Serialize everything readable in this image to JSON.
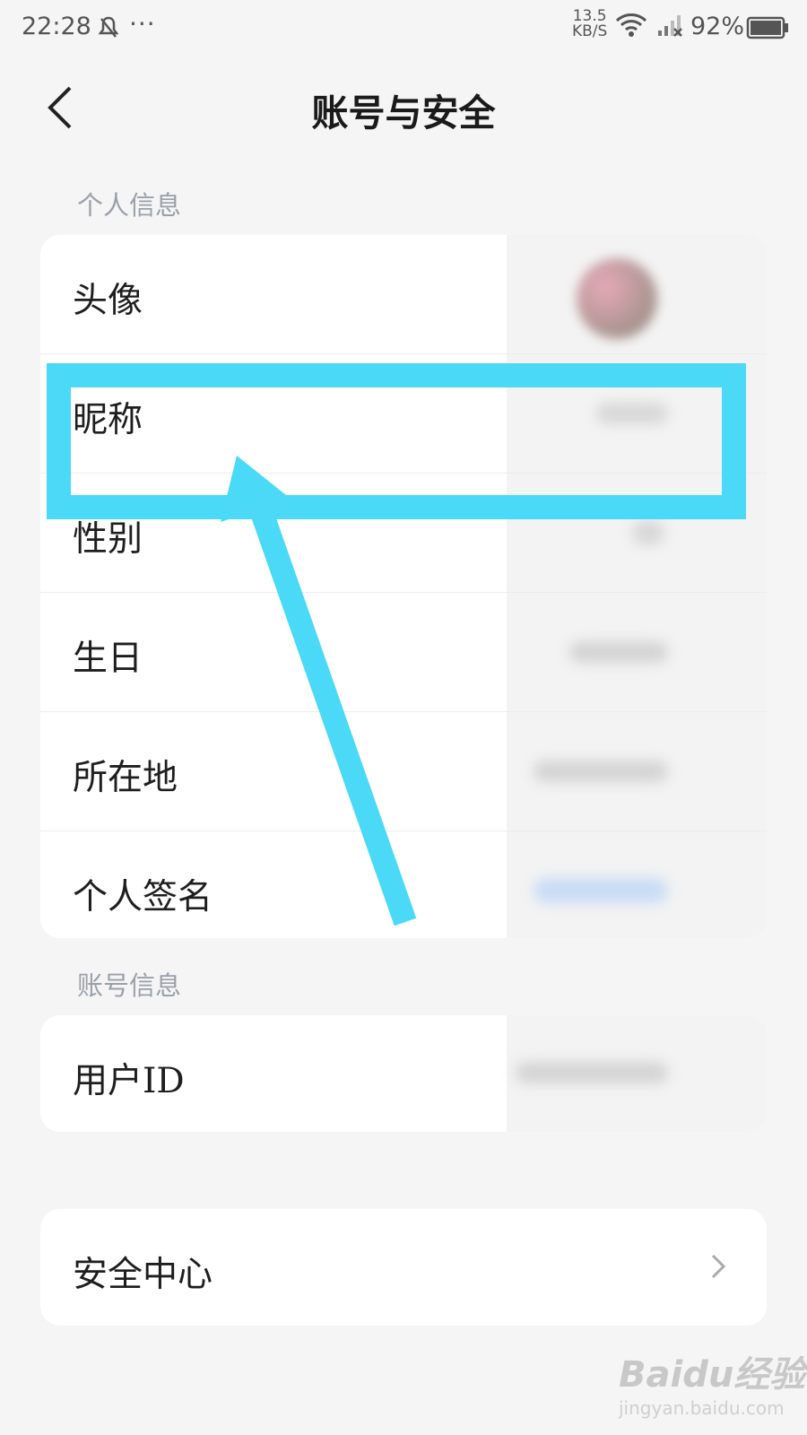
{
  "status_bar": {
    "time": "22:28",
    "net_speed_value": "13.5",
    "net_speed_unit": "KB/S",
    "battery": "92%",
    "icons": [
      "bell-off-icon",
      "more-icon",
      "wifi-icon",
      "signal-icon",
      "battery-icon"
    ]
  },
  "header": {
    "title": "账号与安全",
    "back_icon": "chevron-left-icon"
  },
  "sections": {
    "personal": {
      "label": "个人信息",
      "rows": [
        "头像",
        "昵称",
        "性别",
        "生日",
        "所在地",
        "个人签名"
      ]
    },
    "account": {
      "label": "账号信息",
      "rows": [
        "用户ID"
      ]
    }
  },
  "security": {
    "label": "安全中心",
    "icon": "chevron-right-icon"
  },
  "annotation": {
    "highlight_color": "#4ad9f7"
  },
  "watermark": {
    "brand": "Baidu经验",
    "url": "jingyan.baidu.com"
  }
}
